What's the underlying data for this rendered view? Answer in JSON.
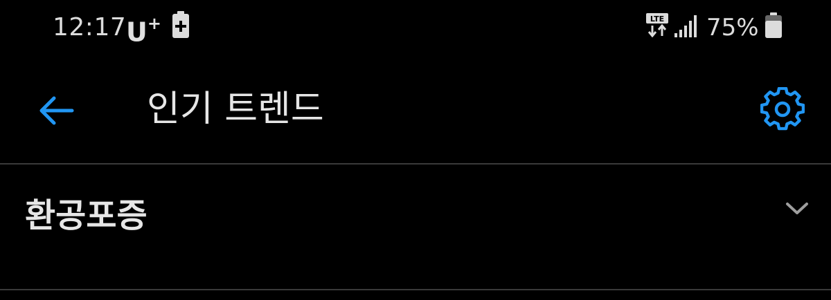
{
  "status_bar": {
    "time": "12:17",
    "carrier": "U",
    "carrier_plus": "+",
    "battery_percent": "75%",
    "network_type": "LTE",
    "battery_level": 0.75
  },
  "app_bar": {
    "title": "인기 트렌드"
  },
  "trends": {
    "items": [
      {
        "label": "환공포증",
        "expanded": false
      }
    ]
  },
  "colors": {
    "background": "#000000",
    "text": "#e6e6e6",
    "accent": "#2196f3",
    "divider": "#3a3a3a",
    "chevron": "#9e9e9e"
  }
}
